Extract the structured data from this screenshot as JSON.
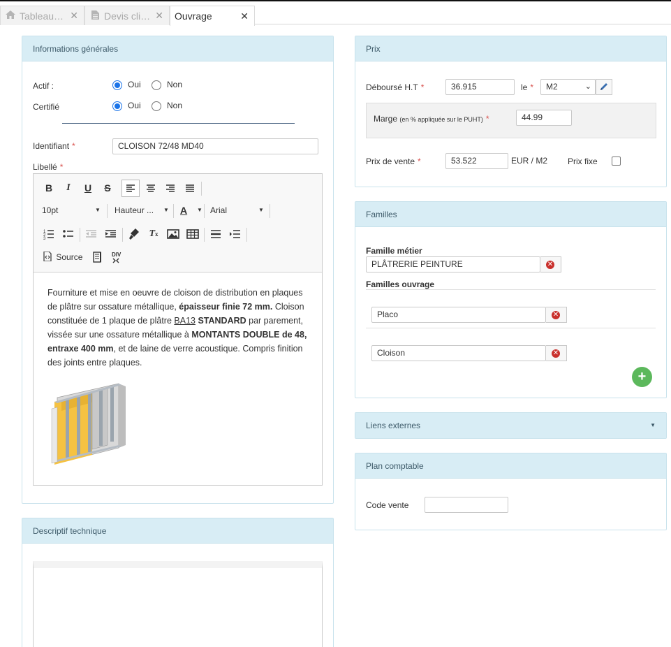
{
  "tabs": [
    {
      "label": "Tableau…",
      "icon": "home-icon"
    },
    {
      "label": "Devis cli…",
      "icon": "document-icon"
    },
    {
      "label": "Ouvrage",
      "icon": ""
    }
  ],
  "general": {
    "title": "Informations générales",
    "actif_label": "Actif :",
    "certifie_label": "Certifié",
    "oui": "Oui",
    "non": "Non",
    "actif_value": "Oui",
    "certifie_value": "Oui",
    "identifiant_label": "Identifiant",
    "identifiant_value": "CLOISON 72/48 MD40",
    "libelle_label": "Libellé",
    "required_mark": "*"
  },
  "editor": {
    "font_size": "10pt",
    "line_height": "Hauteur ...",
    "font_family": "Arial",
    "text_color_label": "A",
    "source_label": "Source",
    "content": {
      "p1": "Fourniture et mise en oeuvre de cloison de distribution en plaques de plâtre sur ossature métallique, ",
      "b1": "épaisseur finie 72 mm.",
      "p2": " Cloison constituée de 1 plaque de plâtre ",
      "u1": "BA13",
      "b2": " STANDARD",
      "p3": " par parement, vissée sur une ossature métallique à ",
      "b3": "MONTANTS DOUBLE de 48, entraxe 400 mm",
      "p4": ", et de laine de verre acoustique. Compris finition des joints entre plaques."
    }
  },
  "descriptif": {
    "title": "Descriptif technique"
  },
  "prix": {
    "title": "Prix",
    "debourse_label": "Déboursé H.T",
    "debourse_value": "36.915",
    "le_label": "le",
    "unit_value": "M2",
    "marge_label": "Marge",
    "marge_hint": "(en % appliquée sur le PUHT)",
    "marge_value": "44.99",
    "prix_vente_label": "Prix de vente",
    "prix_vente_value": "53.522",
    "currency_unit": "EUR / M2",
    "prix_fixe_label": "Prix fixe",
    "prix_fixe_checked": false
  },
  "familles": {
    "title": "Familles",
    "metier_label": "Famille métier",
    "metier_value": "PLÂTRERIE PEINTURE",
    "ouvrage_label": "Familles ouvrage",
    "ouvrage_items": [
      "Placo",
      "Cloison"
    ],
    "add_label": "+"
  },
  "liens": {
    "title": "Liens externes"
  },
  "plan": {
    "title": "Plan comptable",
    "code_vente_label": "Code vente",
    "code_vente_value": ""
  },
  "colors": {
    "panel_header": "#d8edf5",
    "panel_border": "#c8e2ec",
    "required": "#d9534f",
    "radio": "#1a73e8",
    "add_button": "#5cb85c",
    "remove_button": "#c9302c"
  }
}
